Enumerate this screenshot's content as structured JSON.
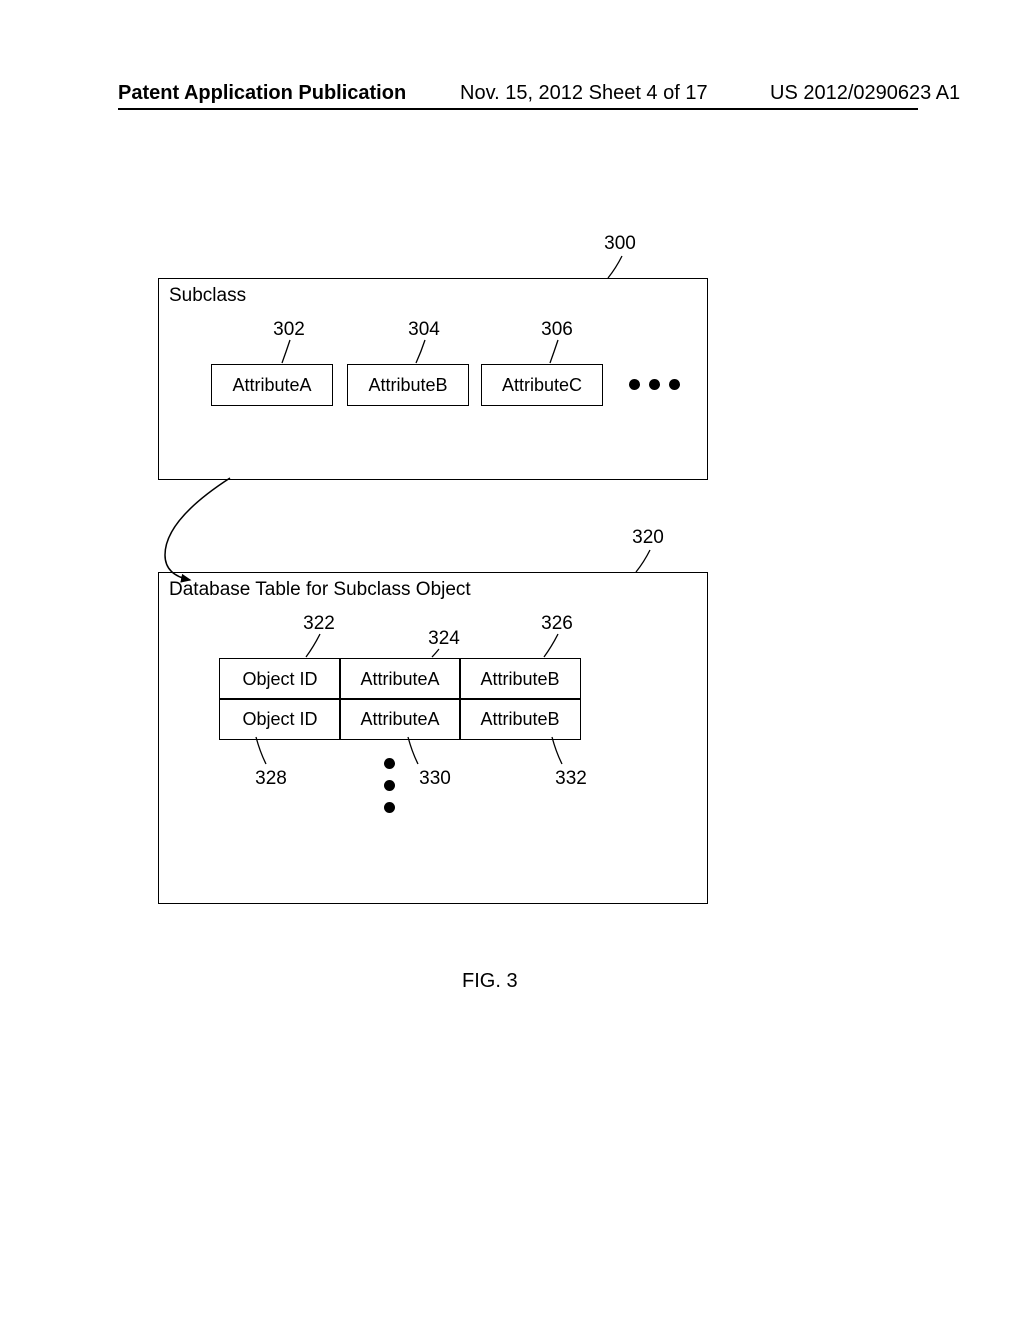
{
  "header": {
    "left": "Patent Application Publication",
    "mid": "Nov. 15, 2012  Sheet 4 of 17",
    "right": "US 2012/0290623 A1"
  },
  "box_top": {
    "ref": "300",
    "title": "Subclass",
    "attrs": {
      "a": {
        "label": "AttributeA",
        "ref": "302"
      },
      "b": {
        "label": "AttributeB",
        "ref": "304"
      },
      "c": {
        "label": "AttributeC",
        "ref": "306"
      }
    }
  },
  "box_bottom": {
    "ref": "320",
    "title": "Database Table for Subclass Object",
    "cols": {
      "c1": {
        "h1": "Object ID",
        "h2": "Object ID",
        "ref_top": "322",
        "ref_bot": "328"
      },
      "c2": {
        "h1": "AttributeA",
        "h2": "AttributeA",
        "ref_top": "324",
        "ref_bot": "330"
      },
      "c3": {
        "h1": "AttributeB",
        "h2": "AttributeB",
        "ref_top": "326",
        "ref_bot": "332"
      }
    }
  },
  "figure_caption": "FIG. 3"
}
